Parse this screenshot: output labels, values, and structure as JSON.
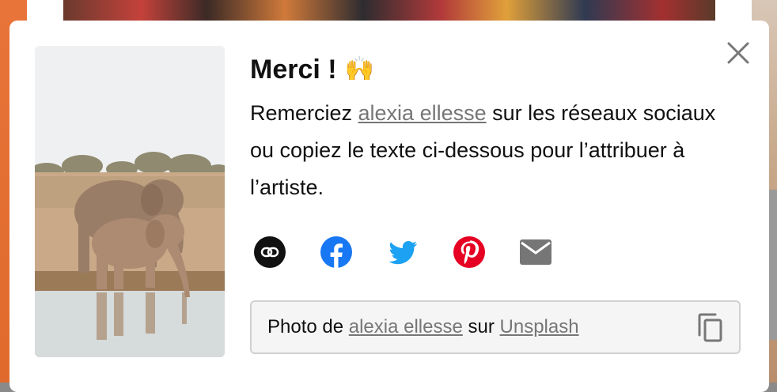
{
  "modal": {
    "title": "Merci !",
    "title_emoji": "🙌",
    "description_prefix": "Remerciez ",
    "artist_name": "alexia ellesse",
    "description_suffix": " sur les réseaux sociaux ou copiez le texte ci-dessous pour l’attribuer à l’artiste.",
    "socials": [
      {
        "name": "link-icon",
        "color": "#111111"
      },
      {
        "name": "facebook-icon",
        "color": "#1877f2"
      },
      {
        "name": "twitter-icon",
        "color": "#1da1f2"
      },
      {
        "name": "pinterest-icon",
        "color": "#e60023"
      },
      {
        "name": "email-icon",
        "color": "#767676"
      }
    ],
    "attribution": {
      "prefix": "Photo de ",
      "artist_name": "alexia ellesse",
      "middle": " sur ",
      "site": "Unsplash"
    }
  },
  "colors": {
    "link": "#767676",
    "text": "#111111",
    "box_border": "#d1d1d1",
    "box_bg": "#f5f5f5"
  }
}
